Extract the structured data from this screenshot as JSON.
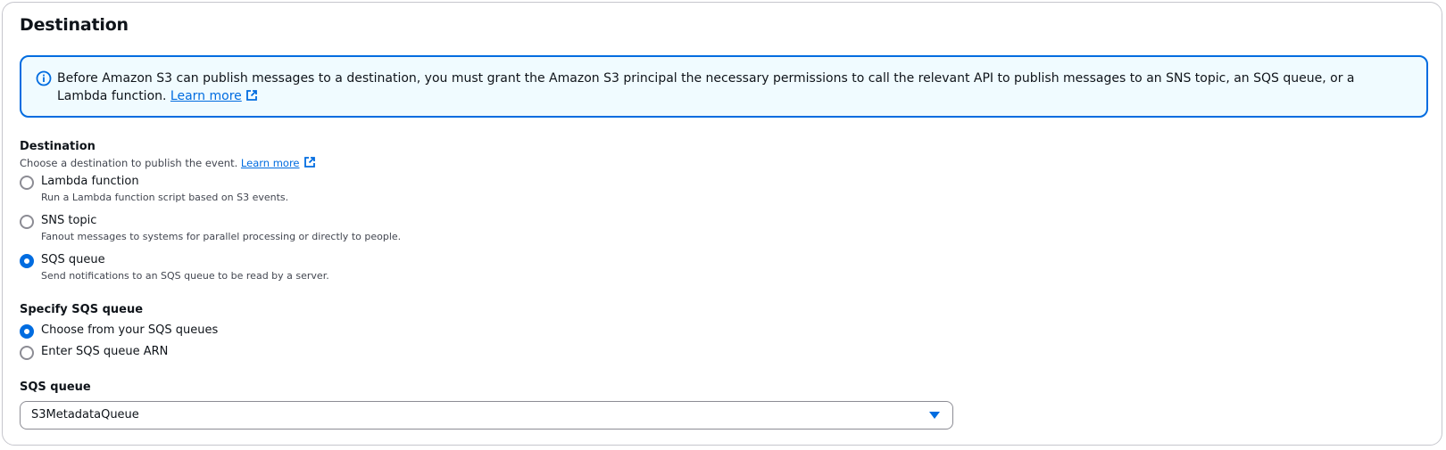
{
  "panel": {
    "title": "Destination"
  },
  "info": {
    "text": "Before Amazon S3 can publish messages to a destination, you must grant the Amazon S3 principal the necessary permissions to call the relevant API to publish messages to an SNS topic, an SQS queue, or a Lambda function. ",
    "link_label": "Learn more",
    "accent_color": "#006ce0",
    "background_color": "#f0fbff"
  },
  "destination": {
    "label": "Destination",
    "description": "Choose a destination to publish the event. ",
    "link_label": "Learn more",
    "options": [
      {
        "label": "Lambda function",
        "description": "Run a Lambda function script based on S3 events.",
        "checked": false
      },
      {
        "label": "SNS topic",
        "description": "Fanout messages to systems for parallel processing or directly to people.",
        "checked": false
      },
      {
        "label": "SQS queue",
        "description": "Send notifications to an SQS queue to be read by a server.",
        "checked": true
      }
    ]
  },
  "specify": {
    "label": "Specify SQS queue",
    "options": [
      {
        "label": "Choose from your SQS queues",
        "checked": true
      },
      {
        "label": "Enter SQS queue ARN",
        "checked": false
      }
    ]
  },
  "queue": {
    "label": "SQS queue",
    "selected": "S3MetadataQueue"
  },
  "icons": {
    "info": "info-icon",
    "external": "external-link-icon",
    "dropdown": "caret-down-icon"
  }
}
